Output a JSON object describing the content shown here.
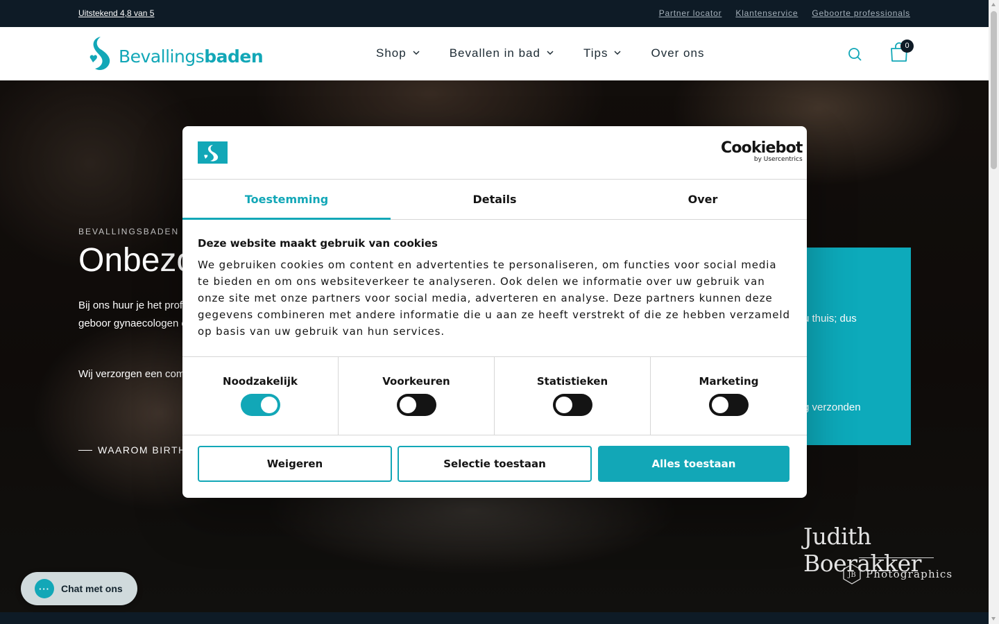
{
  "topbar": {
    "rating": " Uitstekend 4,8 van 5",
    "links": [
      "Partner locator",
      "Klantenservice",
      "Geboorte professionals"
    ]
  },
  "header": {
    "logo_regular": "Bevallings",
    "logo_bold": "baden",
    "nav": [
      "Shop",
      "Bevallen in bad",
      "Tips",
      "Over ons"
    ],
    "cart_count": "0"
  },
  "hero": {
    "eyebrow": "BEVALLINGSBADEN",
    "title": "Onbezo",
    "desc": "Bij ons huur je het profe de professionele geboor gynaecologen en zieken",
    "desc2": "Wij verzorgen een comp",
    "cta": "WAAROM BIRTH I"
  },
  "teal_card": {
    "line1": "u thuis; dus",
    "line2": "g verzonden"
  },
  "watermark": {
    "name": "Judith Boerakker",
    "initials": "JB",
    "sub": "Photographics"
  },
  "chat": {
    "label": "Chat met ons",
    "icon": "chat-bubble-icon"
  },
  "cookie_dialog": {
    "brand": "Cookiebot",
    "brand_sub": "by Usercentrics",
    "tabs": [
      "Toestemming",
      "Details",
      "Over"
    ],
    "active_tab": 0,
    "heading": "Deze website maakt gebruik van cookies",
    "body": "We gebruiken cookies om content en advertenties te personaliseren, om functies voor social media te bieden en om ons websiteverkeer te analyseren. Ook delen we informatie over uw gebruik van onze site met onze partners voor social media, adverteren en analyse. Deze partners kunnen deze gegevens combineren met andere informatie die u aan ze heeft verstrekt of die ze hebben verzameld op basis van uw gebruik van hun services.",
    "categories": [
      {
        "label": "Noodzakelijk",
        "enabled": true
      },
      {
        "label": "Voorkeuren",
        "enabled": false
      },
      {
        "label": "Statistieken",
        "enabled": false
      },
      {
        "label": "Marketing",
        "enabled": false
      }
    ],
    "buttons": {
      "reject": "Weigeren",
      "selection": "Selectie toestaan",
      "accept_all": "Alles toestaan"
    }
  },
  "colors": {
    "brand_teal": "#12a7b7",
    "dark_navy": "#0e1b26",
    "switch_off": "#141414"
  }
}
